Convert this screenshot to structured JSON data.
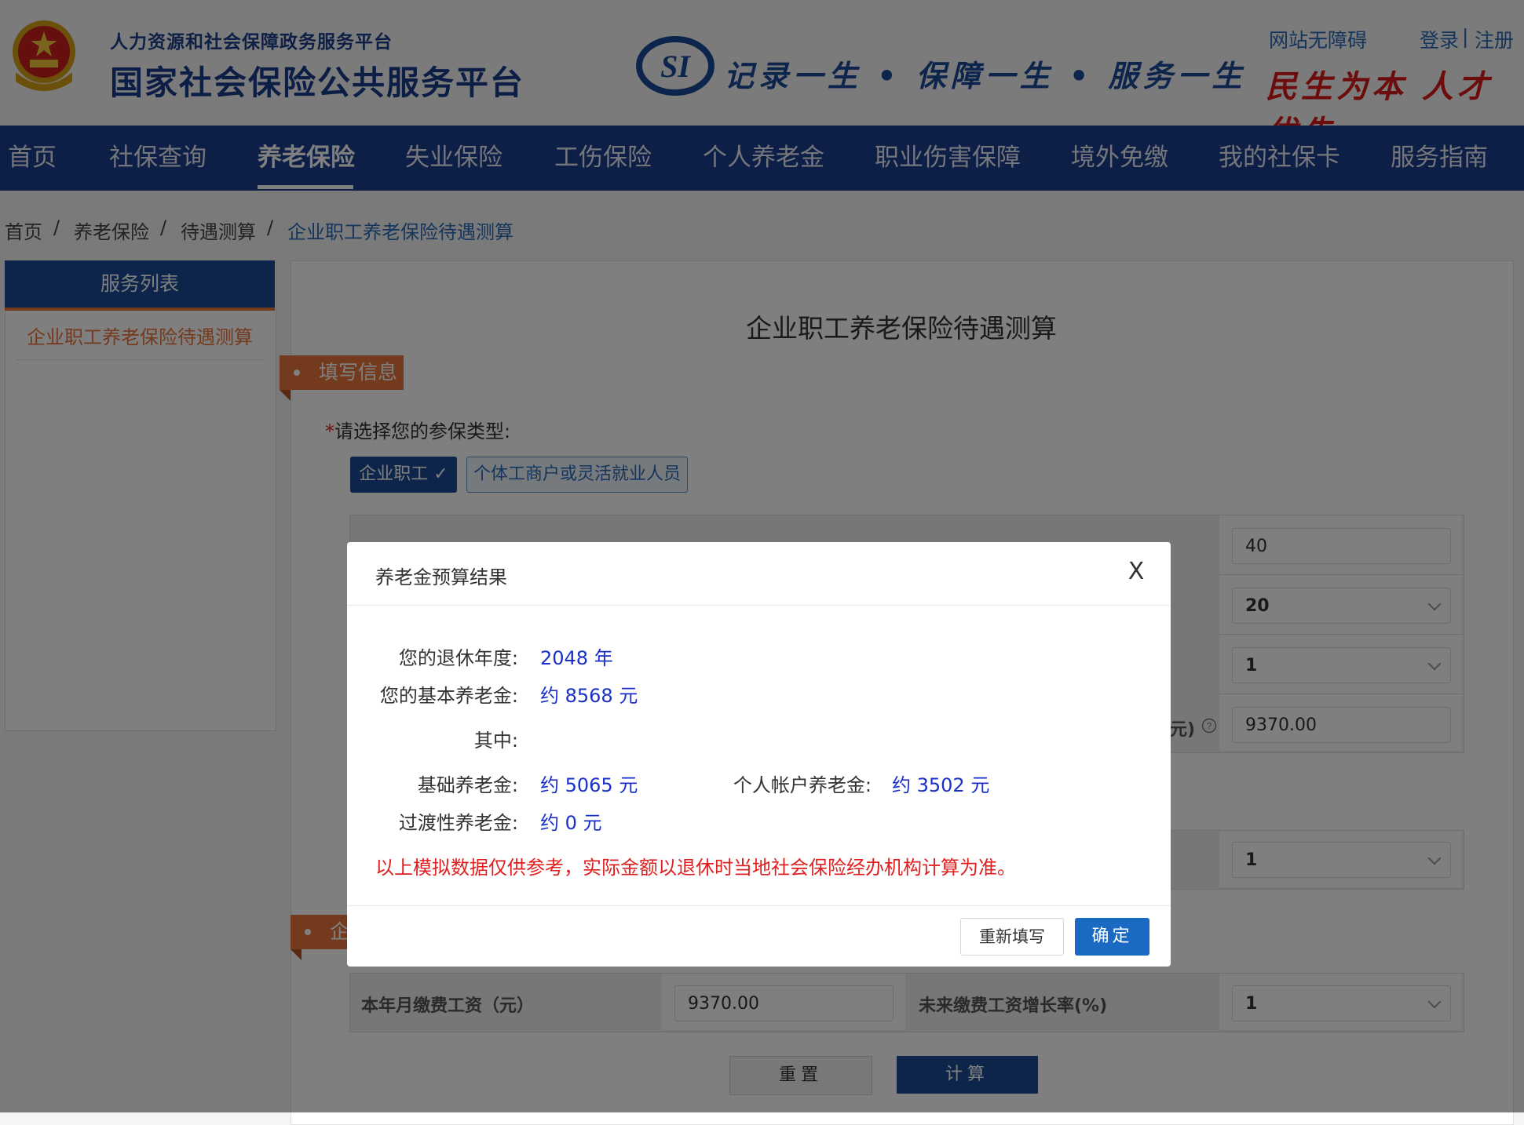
{
  "header": {
    "ministry": "人力资源和社会保障政务服务平台",
    "site_title": "国家社会保险公共服务平台",
    "slogan": "记录一生 • 保障一生 • 服务一生",
    "accessibility": "网站无障碍",
    "login": "登录",
    "separator": "|",
    "register": "注册",
    "motto": "民生为本 人才优先"
  },
  "nav": {
    "items": [
      "首页",
      "社保查询",
      "养老保险",
      "失业保险",
      "工伤保险",
      "个人养老金",
      "职业伤害保障",
      "境外免缴",
      "我的社保卡",
      "服务指南"
    ],
    "active_index": 2
  },
  "breadcrumb": {
    "home": "首页",
    "sep": "/",
    "level1": "养老保险",
    "level2": "待遇测算",
    "current": "企业职工养老保险待遇测算"
  },
  "sidebar": {
    "header": "服务列表",
    "items": [
      "企业职工养老保险待遇测算"
    ]
  },
  "main": {
    "title": "企业职工养老保险待遇测算",
    "section_fill": "填写信息",
    "section_second_partial": "企",
    "required_star": "*",
    "insurance_type_label": "请选择您的参保类型:",
    "type_options": [
      "企业职工 ✓",
      "个体工商户或灵活就业人员"
    ],
    "fields": {
      "age_value": "40",
      "years_select": "20",
      "select_row3": "1",
      "partial_label": "元)",
      "salary_value_top": "9370.00",
      "select_row5": "1",
      "current_wage_label": "本年月缴费工资（元）",
      "current_wage_value": "9370.00",
      "growth_label": "未来缴费工资增长率(%)",
      "growth_value": "1"
    },
    "reset_button": "重置",
    "calc_button": "计算"
  },
  "modal": {
    "title": "养老金预算结果",
    "close": "X",
    "retire_year_label": "您的退休年度:",
    "retire_year_value": "2048 年",
    "basic_pension_label": "您的基本养老金:",
    "basic_pension_value": "约 8568 元",
    "among_label": "其中:",
    "base_pension_label": "基础养老金:",
    "base_pension_value": "约 5065 元",
    "personal_pension_label": "个人帐户养老金:",
    "personal_pension_value": "约 3502 元",
    "transition_label": "过渡性养老金:",
    "transition_value": "约 0 元",
    "note": "以上模拟数据仅供参考，实际金额以退休时当地社会保险经办机构计算为准。",
    "refill_button": "重新填写",
    "ok_button": "确定"
  },
  "colors": {
    "nav_blue": "#1a3e8c",
    "accent_orange": "#e8743b",
    "value_blue": "#1a2fc8",
    "warning_red": "#e02020",
    "ok_blue": "#1a6ac4"
  }
}
